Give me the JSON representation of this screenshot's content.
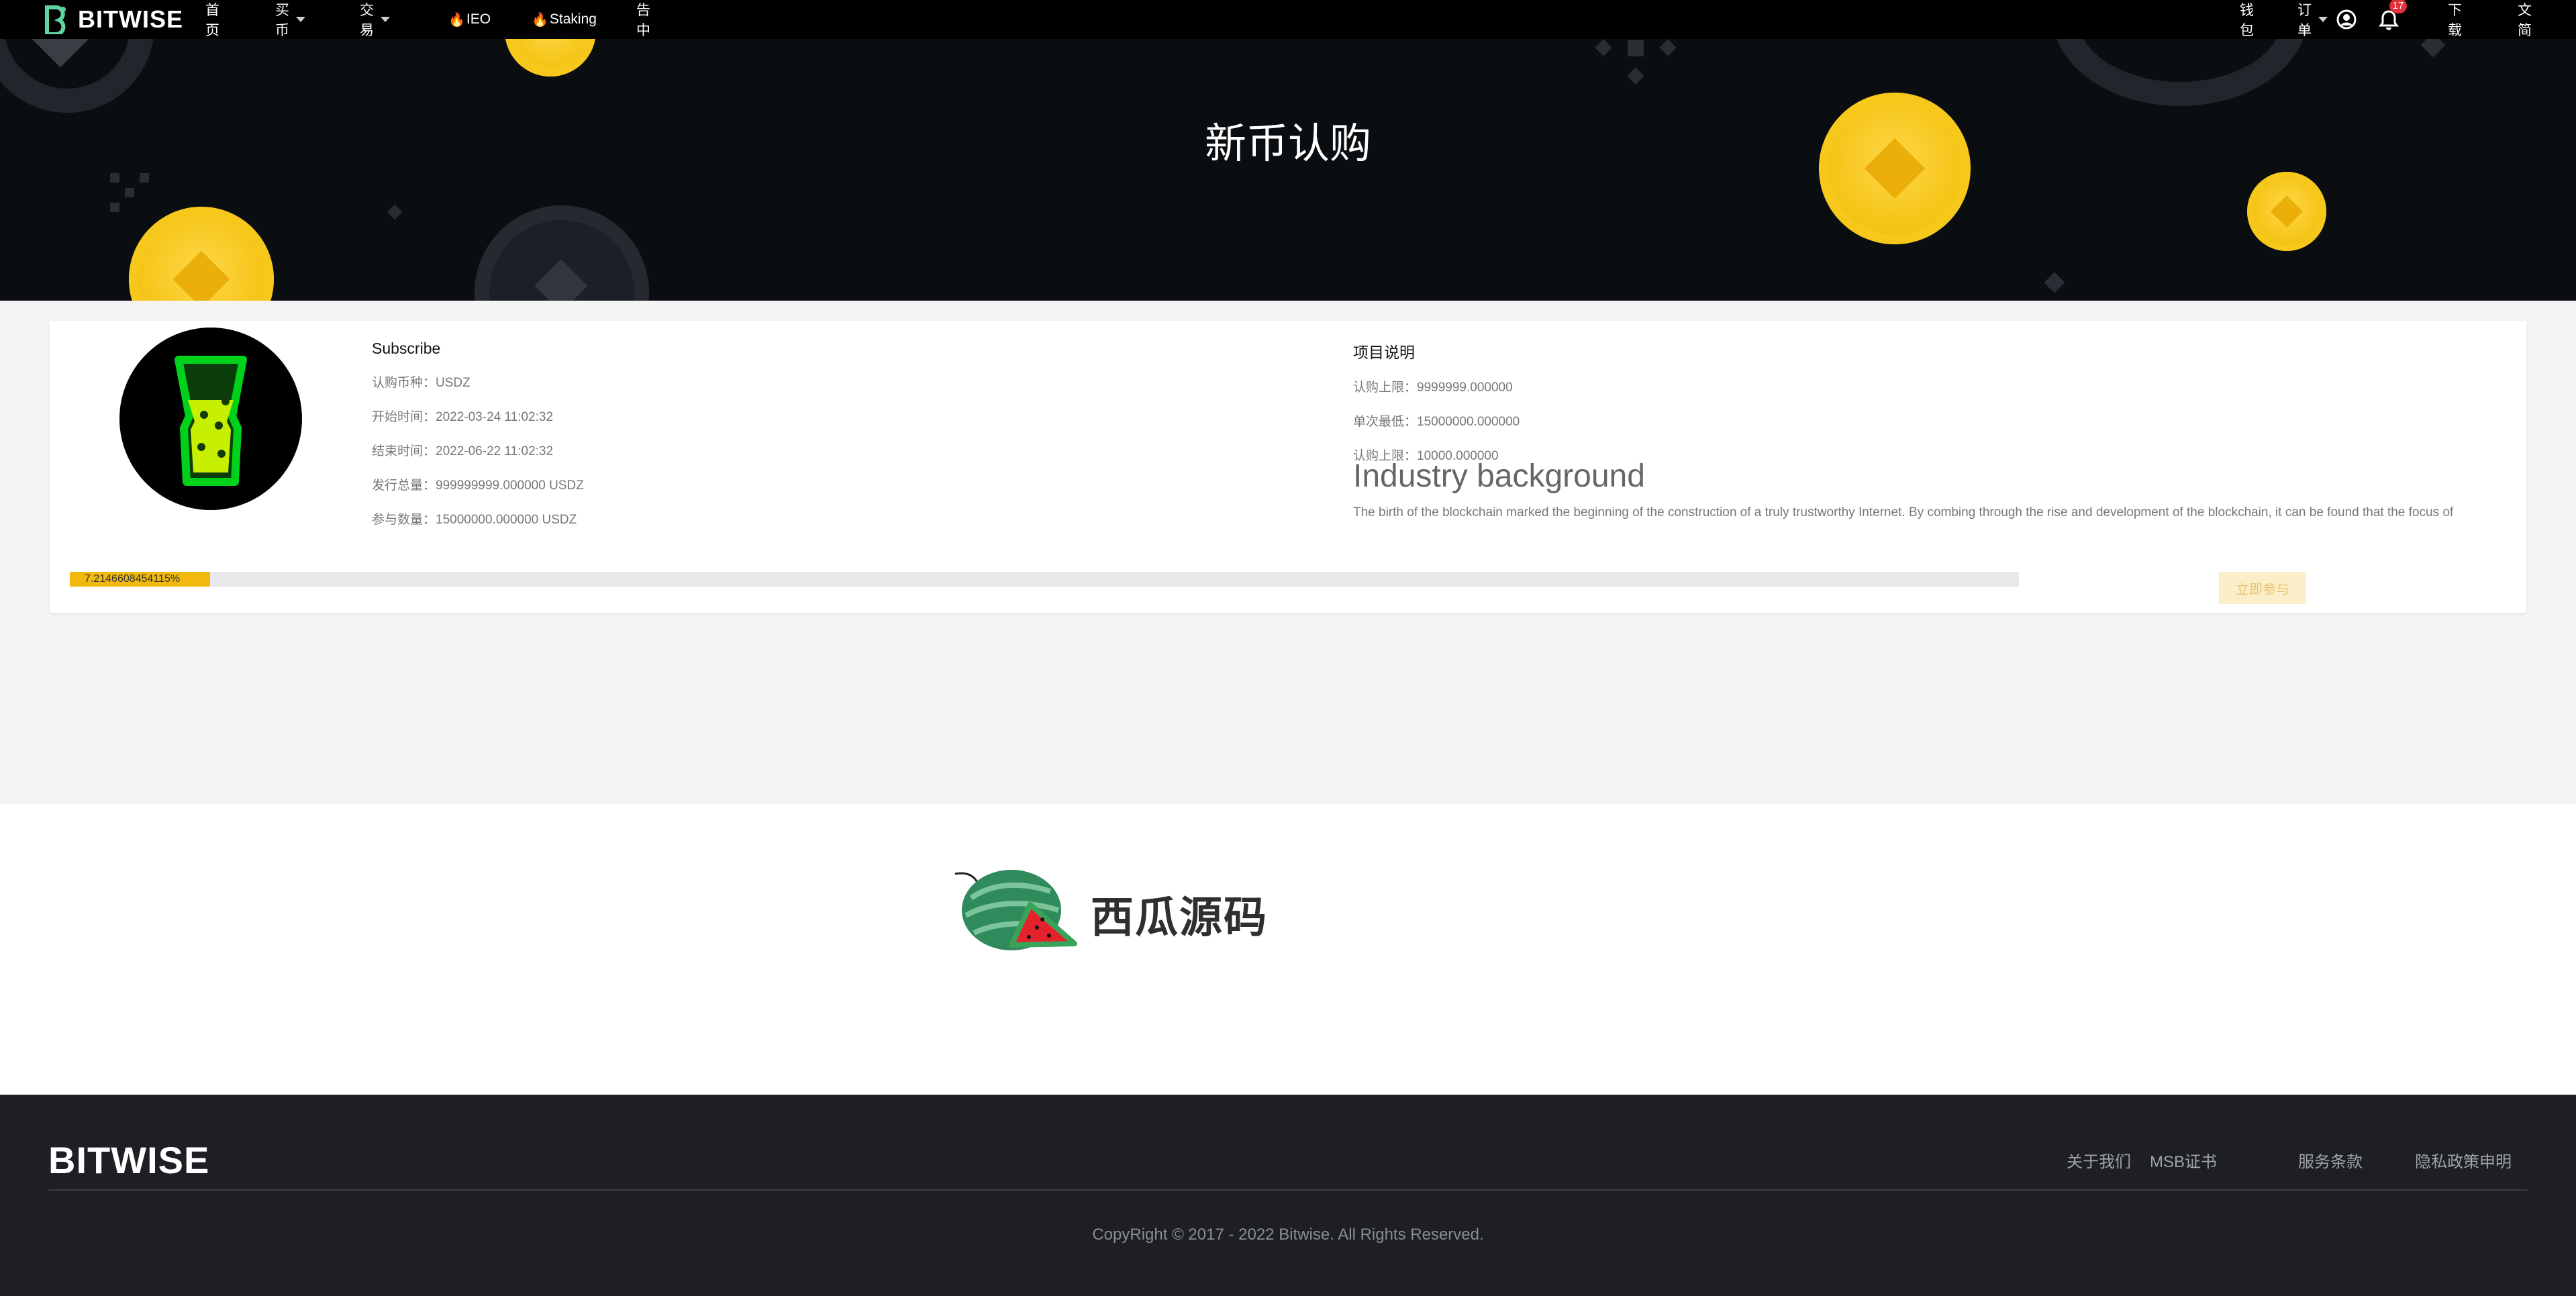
{
  "nav": {
    "brand": "BITWISE",
    "left_items": [
      {
        "label": "首页",
        "caret": false,
        "hot": false
      },
      {
        "label": "买币",
        "caret": true,
        "hot": false
      },
      {
        "label": "交易",
        "caret": true,
        "hot": false
      },
      {
        "label": "IEO",
        "caret": false,
        "hot": true
      },
      {
        "label": "Staking",
        "caret": false,
        "hot": true
      },
      {
        "label": "公告中心",
        "caret": false,
        "hot": false
      }
    ],
    "wallet": "钱包",
    "orders": "订单",
    "notification_count": "17",
    "download": "下载",
    "language": "中文简体"
  },
  "hero": {
    "title": "新币认购"
  },
  "project": {
    "name": "Subscribe",
    "fields": [
      {
        "label": "认购币种：",
        "value": "USDZ"
      },
      {
        "label": "开始时间：",
        "value": "2022-03-24 11:02:32"
      },
      {
        "label": "结束时间：",
        "value": "2022-06-22 11:02:32"
      },
      {
        "label": "发行总量：",
        "value": "999999999.000000 USDZ"
      },
      {
        "label": "参与数量：",
        "value": "15000000.000000 USDZ"
      }
    ],
    "description_title": "项目说明",
    "limits": [
      {
        "label": "认购上限：",
        "value": "9999999.000000"
      },
      {
        "label": "单次最低：",
        "value": "15000000.000000"
      },
      {
        "label": "认购上限：",
        "value": "10000.000000"
      }
    ],
    "industry_title": "Industry background",
    "industry_text": "The birth of the blockchain marked the beginning of the construction of a truly trustworthy Internet. By combing through the rise and development of the blockchain, it can be found that the focus of",
    "progress_label": "7.2146608454115%",
    "progress_fraction": 0.0721,
    "join_label": "立即参与"
  },
  "watermark": {
    "text": "西瓜源码"
  },
  "footer": {
    "brand": "BITWISE",
    "links": [
      "关于我们",
      "MSB证书",
      "服务条款",
      "隐私政策申明"
    ],
    "copyright": "CopyRight © 2017 - 2022 Bitwise. All Rights Reserved."
  },
  "colors": {
    "accent": "#f0b90b",
    "nav_bg": "#000000",
    "hero_bg": "#0b0e11",
    "footer_bg": "#1d1f24",
    "badge": "#e0313a"
  }
}
